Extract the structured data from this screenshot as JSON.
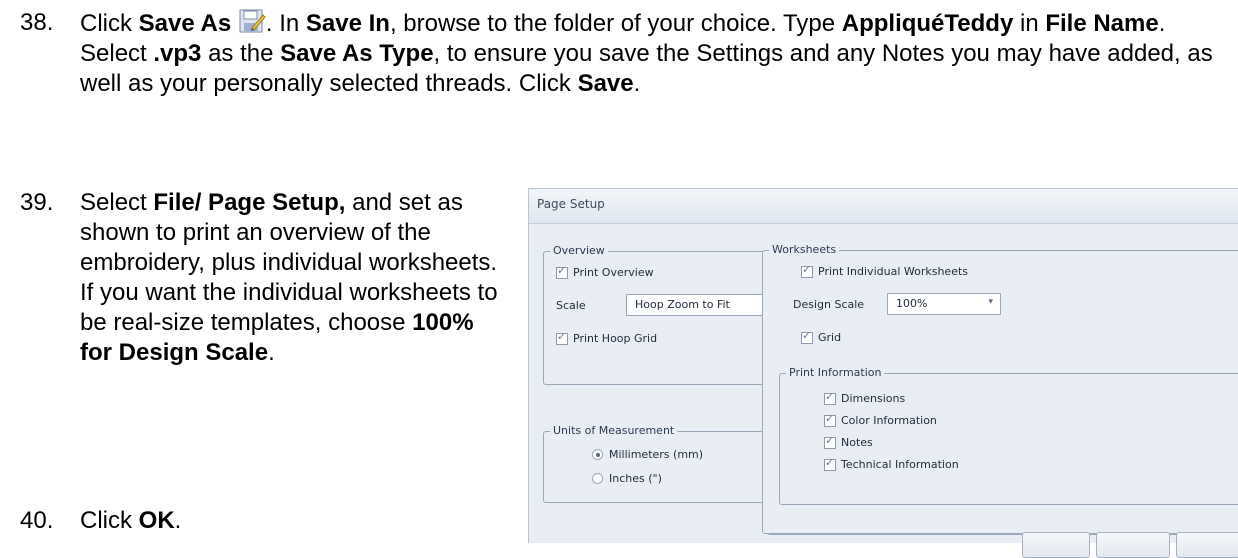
{
  "step38": {
    "number": "38.",
    "t1": "Click ",
    "b1": "Save As",
    "t2": ".  In ",
    "b2": "Save In",
    "t3": ", browse to the folder of your choice.  Type ",
    "b3": "AppliquéTeddy",
    "t4": " in ",
    "b4": "File Name",
    "t5": ".  Select ",
    "b5": ".vp3",
    "t6": " as the ",
    "b6": "Save As Type",
    "t7": ", to ensure you save the Settings and any Notes you may have added, as well as your personally selected threads.  Click ",
    "b7": "Save",
    "t8": ".",
    "icon": "save-as-icon"
  },
  "step39": {
    "number": "39.",
    "t1": "Select ",
    "b1": "File/ Page Setup,",
    "t2": " and set as shown to print an overview of the embroidery, plus individual worksheets.  If you want the individual worksheets to be real-size templates, choose ",
    "b2": "100% for Design Scale",
    "t3": "."
  },
  "step40": {
    "number": "40.",
    "t1": "Click ",
    "b1": "OK",
    "t2": "."
  },
  "dialog": {
    "title": "Page Setup",
    "overview": {
      "label": "Overview",
      "print_overview": "Print Overview",
      "print_overview_checked": true,
      "scale_label": "Scale",
      "scale_value": "Hoop Zoom to Fit",
      "print_hoop_grid": "Print Hoop Grid",
      "print_hoop_grid_checked": true
    },
    "units": {
      "label": "Units of Measurement",
      "mm": "Millimeters (mm)",
      "inches": "Inches (\")",
      "selected": "mm"
    },
    "worksheets": {
      "label": "Worksheets",
      "print_individual": "Print Individual Worksheets",
      "design_scale_label": "Design Scale",
      "design_scale_value": "100%",
      "grid": "Grid",
      "print_info_label": "Print Information",
      "dimensions": "Dimensions",
      "color_info": "Color Information",
      "notes": "Notes",
      "technical_info": "Technical Information"
    }
  }
}
